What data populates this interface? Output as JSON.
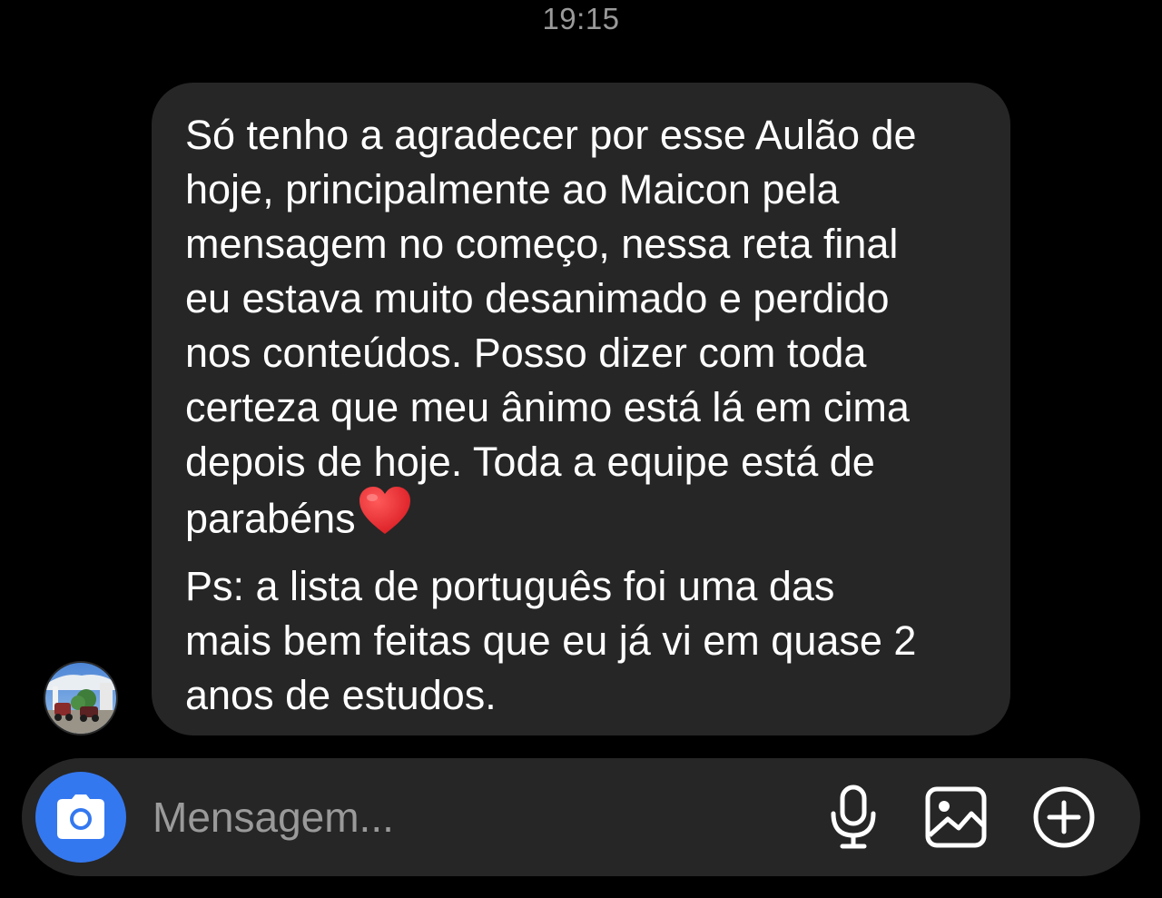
{
  "header": {
    "timestamp": "19:15"
  },
  "message": {
    "lines": [
      "Só tenho a agradecer por esse Aulão de",
      "hoje, principalmente ao Maicon pela",
      "mensagem no começo, nessa reta final",
      "eu estava muito desanimado e perdido",
      "nos conteúdos. Posso dizer com toda",
      "certeza que meu ânimo está lá em cima",
      "depois de hoje. Toda a equipe está de",
      "parabéns"
    ],
    "emoji": "heart",
    "ps_lines": [
      "Ps: a lista de português foi uma das",
      "mais bem feitas que eu já vi em quase 2",
      "anos de estudos."
    ]
  },
  "sender": {
    "avatar_icon": "profile-photo"
  },
  "composer": {
    "placeholder": "Mensagem...",
    "icons": {
      "camera": "camera-icon",
      "microphone": "microphone-icon",
      "gallery": "image-icon",
      "more": "plus-circle-icon"
    }
  },
  "colors": {
    "background": "#000000",
    "bubble": "#262626",
    "composer": "#262626",
    "camera_button": "#3478f0",
    "timestamp": "#9a9a9a",
    "placeholder": "#9a9a9a",
    "heart": "#e8232b"
  }
}
